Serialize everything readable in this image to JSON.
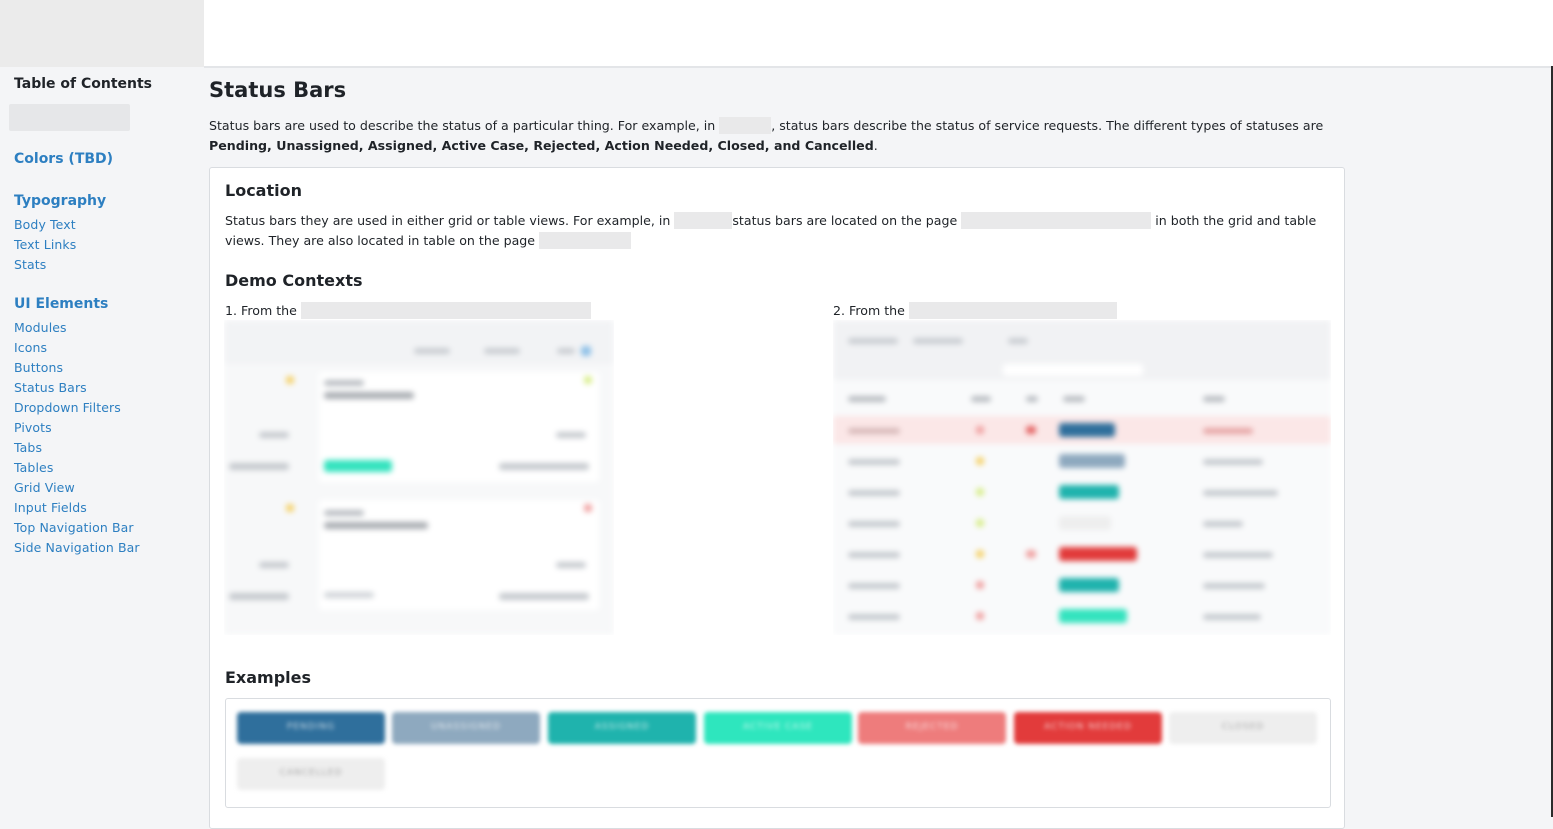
{
  "sidebar": {
    "toc_title": "Table of Contents",
    "sections": [
      {
        "title": "Colors (TBD)",
        "items": []
      },
      {
        "title": "Typography",
        "items": [
          "Body Text",
          "Text Links",
          "Stats"
        ]
      },
      {
        "title": "UI Elements",
        "items": [
          "Modules",
          "Icons",
          "Buttons",
          "Status Bars",
          "Dropdown Filters",
          "Pivots",
          "Tabs",
          "Tables",
          "Grid View",
          "Input Fields",
          "Top Navigation Bar",
          "Side Navigation Bar"
        ]
      }
    ]
  },
  "main": {
    "title": "Status Bars",
    "intro_part1": "Status bars are used to describe the status of a particular thing. For example, in",
    "intro_part2": ", status bars describe the status of service requests. The different types of statuses are",
    "intro_bold": "Pending, Unassigned, Assigned, Active Case, Rejected, Action Needed, Closed, and Cancelled",
    "intro_end": ".",
    "location": {
      "heading": "Location",
      "text_part1": "Status bars they are used in either grid or table views. For example, in",
      "text_part2": "status bars are located on the page",
      "text_part3": "in both the grid and table views. They are also located in table on the page"
    },
    "demo": {
      "heading": "Demo Contexts",
      "context1_label": "1. From the",
      "context2_label": "2. From the"
    },
    "examples": {
      "heading": "Examples",
      "pills": [
        {
          "label": "PENDING",
          "color": "#2f6f9c"
        },
        {
          "label": "UNASSIGNED",
          "color": "#8ea9bf"
        },
        {
          "label": "ASSIGNED",
          "color": "#1fb3ad"
        },
        {
          "label": "ACTIVE CASE",
          "color": "#2ee6be"
        },
        {
          "label": "REJECTED",
          "color": "#ee7c7c"
        },
        {
          "label": "ACTION NEEDED",
          "color": "#e23b3b"
        },
        {
          "label": "CLOSED",
          "color": "#eeeeee"
        },
        {
          "label": "CANCELLED",
          "color": "#eeeeee"
        }
      ]
    }
  }
}
